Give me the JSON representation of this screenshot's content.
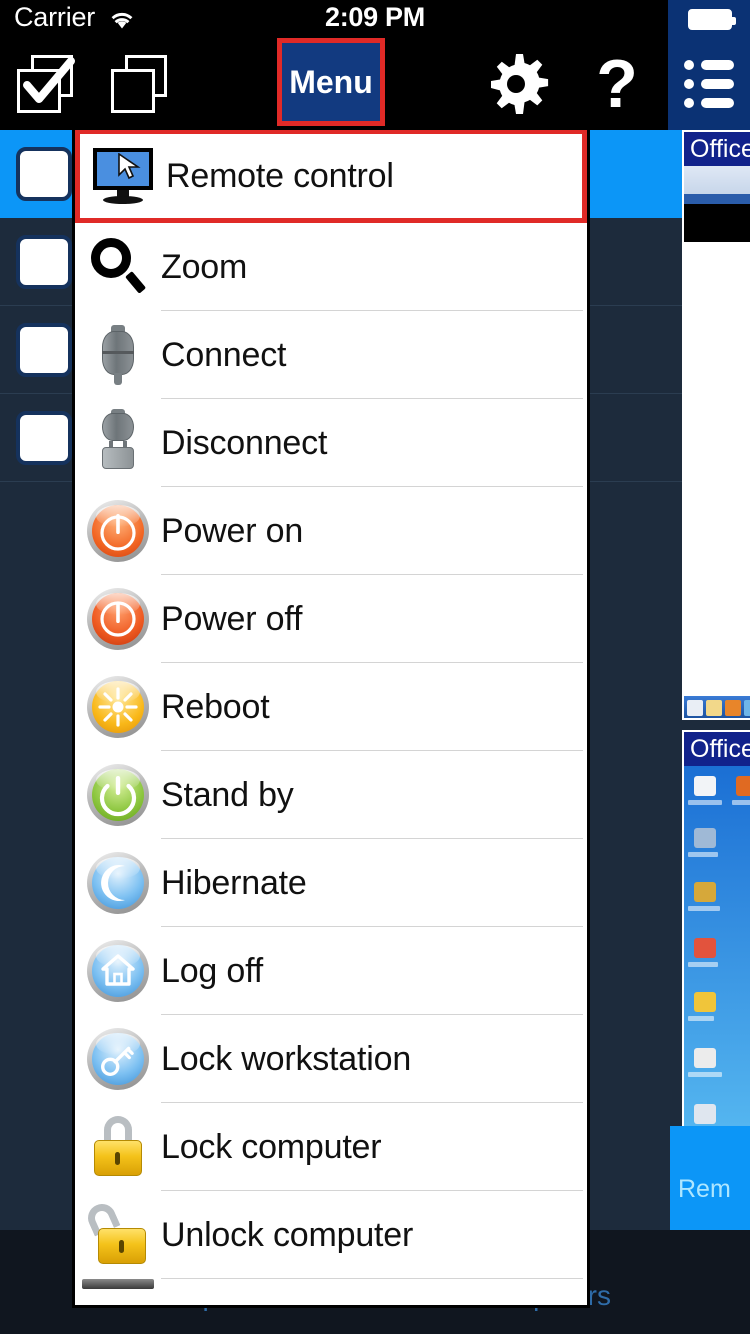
{
  "statusbar": {
    "carrier": "Carrier",
    "wifi_icon": "wifi-icon",
    "time": "2:09 PM",
    "battery_icon": "battery-icon"
  },
  "toolbar": {
    "select_all_icon": "checkbox-stack-icon",
    "deselect_all_icon": "empty-stack-icon",
    "menu_label": "Menu",
    "settings_icon": "gear-icon",
    "help_label": "?",
    "list_icon": "list-view-icon",
    "menu_highlight_color": "#e02a27",
    "menu_button_bg": "#123a80",
    "right_pane_bg": "#0b3274"
  },
  "menu": {
    "highlight_color": "#e02a27",
    "items": [
      {
        "label": "Remote control",
        "icon": "monitor-cursor-icon",
        "highlighted": true
      },
      {
        "label": "Zoom",
        "icon": "magnifier-icon",
        "highlighted": false
      },
      {
        "label": "Connect",
        "icon": "plug-connect-icon",
        "highlighted": false
      },
      {
        "label": "Disconnect",
        "icon": "plug-disconnect-icon",
        "highlighted": false
      },
      {
        "label": "Power on",
        "icon": "power-on-icon",
        "highlighted": false
      },
      {
        "label": "Power off",
        "icon": "power-off-icon",
        "highlighted": false
      },
      {
        "label": "Reboot",
        "icon": "reboot-icon",
        "highlighted": false
      },
      {
        "label": "Stand by",
        "icon": "standby-icon",
        "highlighted": false
      },
      {
        "label": "Hibernate",
        "icon": "hibernate-moon-icon",
        "highlighted": false
      },
      {
        "label": "Log off",
        "icon": "log-off-home-icon",
        "highlighted": false
      },
      {
        "label": "Lock workstation",
        "icon": "key-icon",
        "highlighted": false
      },
      {
        "label": "Lock computer",
        "icon": "padlock-closed-icon",
        "highlighted": false
      },
      {
        "label": "Unlock computer",
        "icon": "padlock-open-icon",
        "highlighted": false
      }
    ]
  },
  "background_list": {
    "selected_row_color": "#0c96f7",
    "row_bg": "#1d2b3c",
    "rows": [
      {
        "checked": false,
        "selected": true
      },
      {
        "checked": false,
        "selected": false
      },
      {
        "checked": false,
        "selected": false
      },
      {
        "checked": false,
        "selected": false
      }
    ]
  },
  "thumbnails": [
    {
      "title": "Office"
    },
    {
      "title": "Office"
    }
  ],
  "side_panel": {
    "remote_label": "Rem",
    "bg": "#0c96f7"
  },
  "bottombar": {
    "add_label": "Add computer",
    "find_label": "Find computers",
    "tab_color": "#2f6ca8"
  }
}
